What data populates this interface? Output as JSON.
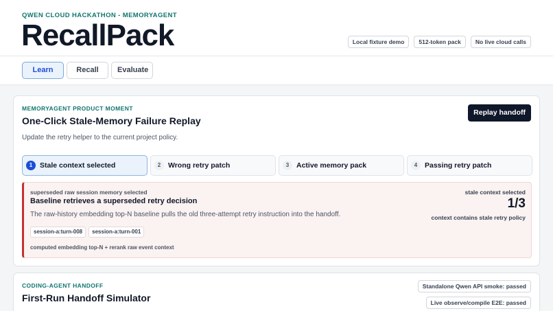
{
  "header": {
    "eyebrow": "QWEN CLOUD HACKATHON - MEMORYAGENT",
    "title": "RecallPack",
    "chips": [
      "Local fixture demo",
      "512-token pack",
      "No live cloud calls"
    ]
  },
  "tabs": [
    {
      "label": "Learn",
      "active": true
    },
    {
      "label": "Recall",
      "active": false
    },
    {
      "label": "Evaluate",
      "active": false
    }
  ],
  "moment": {
    "eyebrow": "MEMORYAGENT PRODUCT MOMENT",
    "title": "One-Click Stale-Memory Failure Replay",
    "description": "Update the retry helper to the current project policy.",
    "replay_label": "Replay handoff",
    "steps": [
      {
        "num": "1",
        "label": "Stale context selected",
        "active": true
      },
      {
        "num": "2",
        "label": "Wrong retry patch",
        "active": false
      },
      {
        "num": "3",
        "label": "Active memory pack",
        "active": false
      },
      {
        "num": "4",
        "label": "Passing retry patch",
        "active": false
      }
    ],
    "alert": {
      "eyebrow": "superseded raw session memory selected",
      "title": "Baseline retrieves a superseded retry decision",
      "description": "The raw-history embedding top-N baseline pulls the old three-attempt retry instruction into the handoff.",
      "chips": [
        "session-a:turn-008",
        "session-a:turn-001"
      ],
      "footnote": "computed embedding top-N + rerank raw event context",
      "metric_label": "stale context selected",
      "metric_value": "1/3",
      "metric_note": "context contains stale retry policy"
    }
  },
  "handoff": {
    "eyebrow": "CODING-AGENT HANDOFF",
    "title": "First-Run Handoff Simulator",
    "status_chips": [
      "Standalone Qwen API smoke: passed",
      "Live observe/compile E2E: passed"
    ]
  },
  "colors": {
    "accent": "#1d4ed8",
    "eyebrow_teal": "#0f766e",
    "danger": "#c53030",
    "dark_button": "#0f172a"
  }
}
